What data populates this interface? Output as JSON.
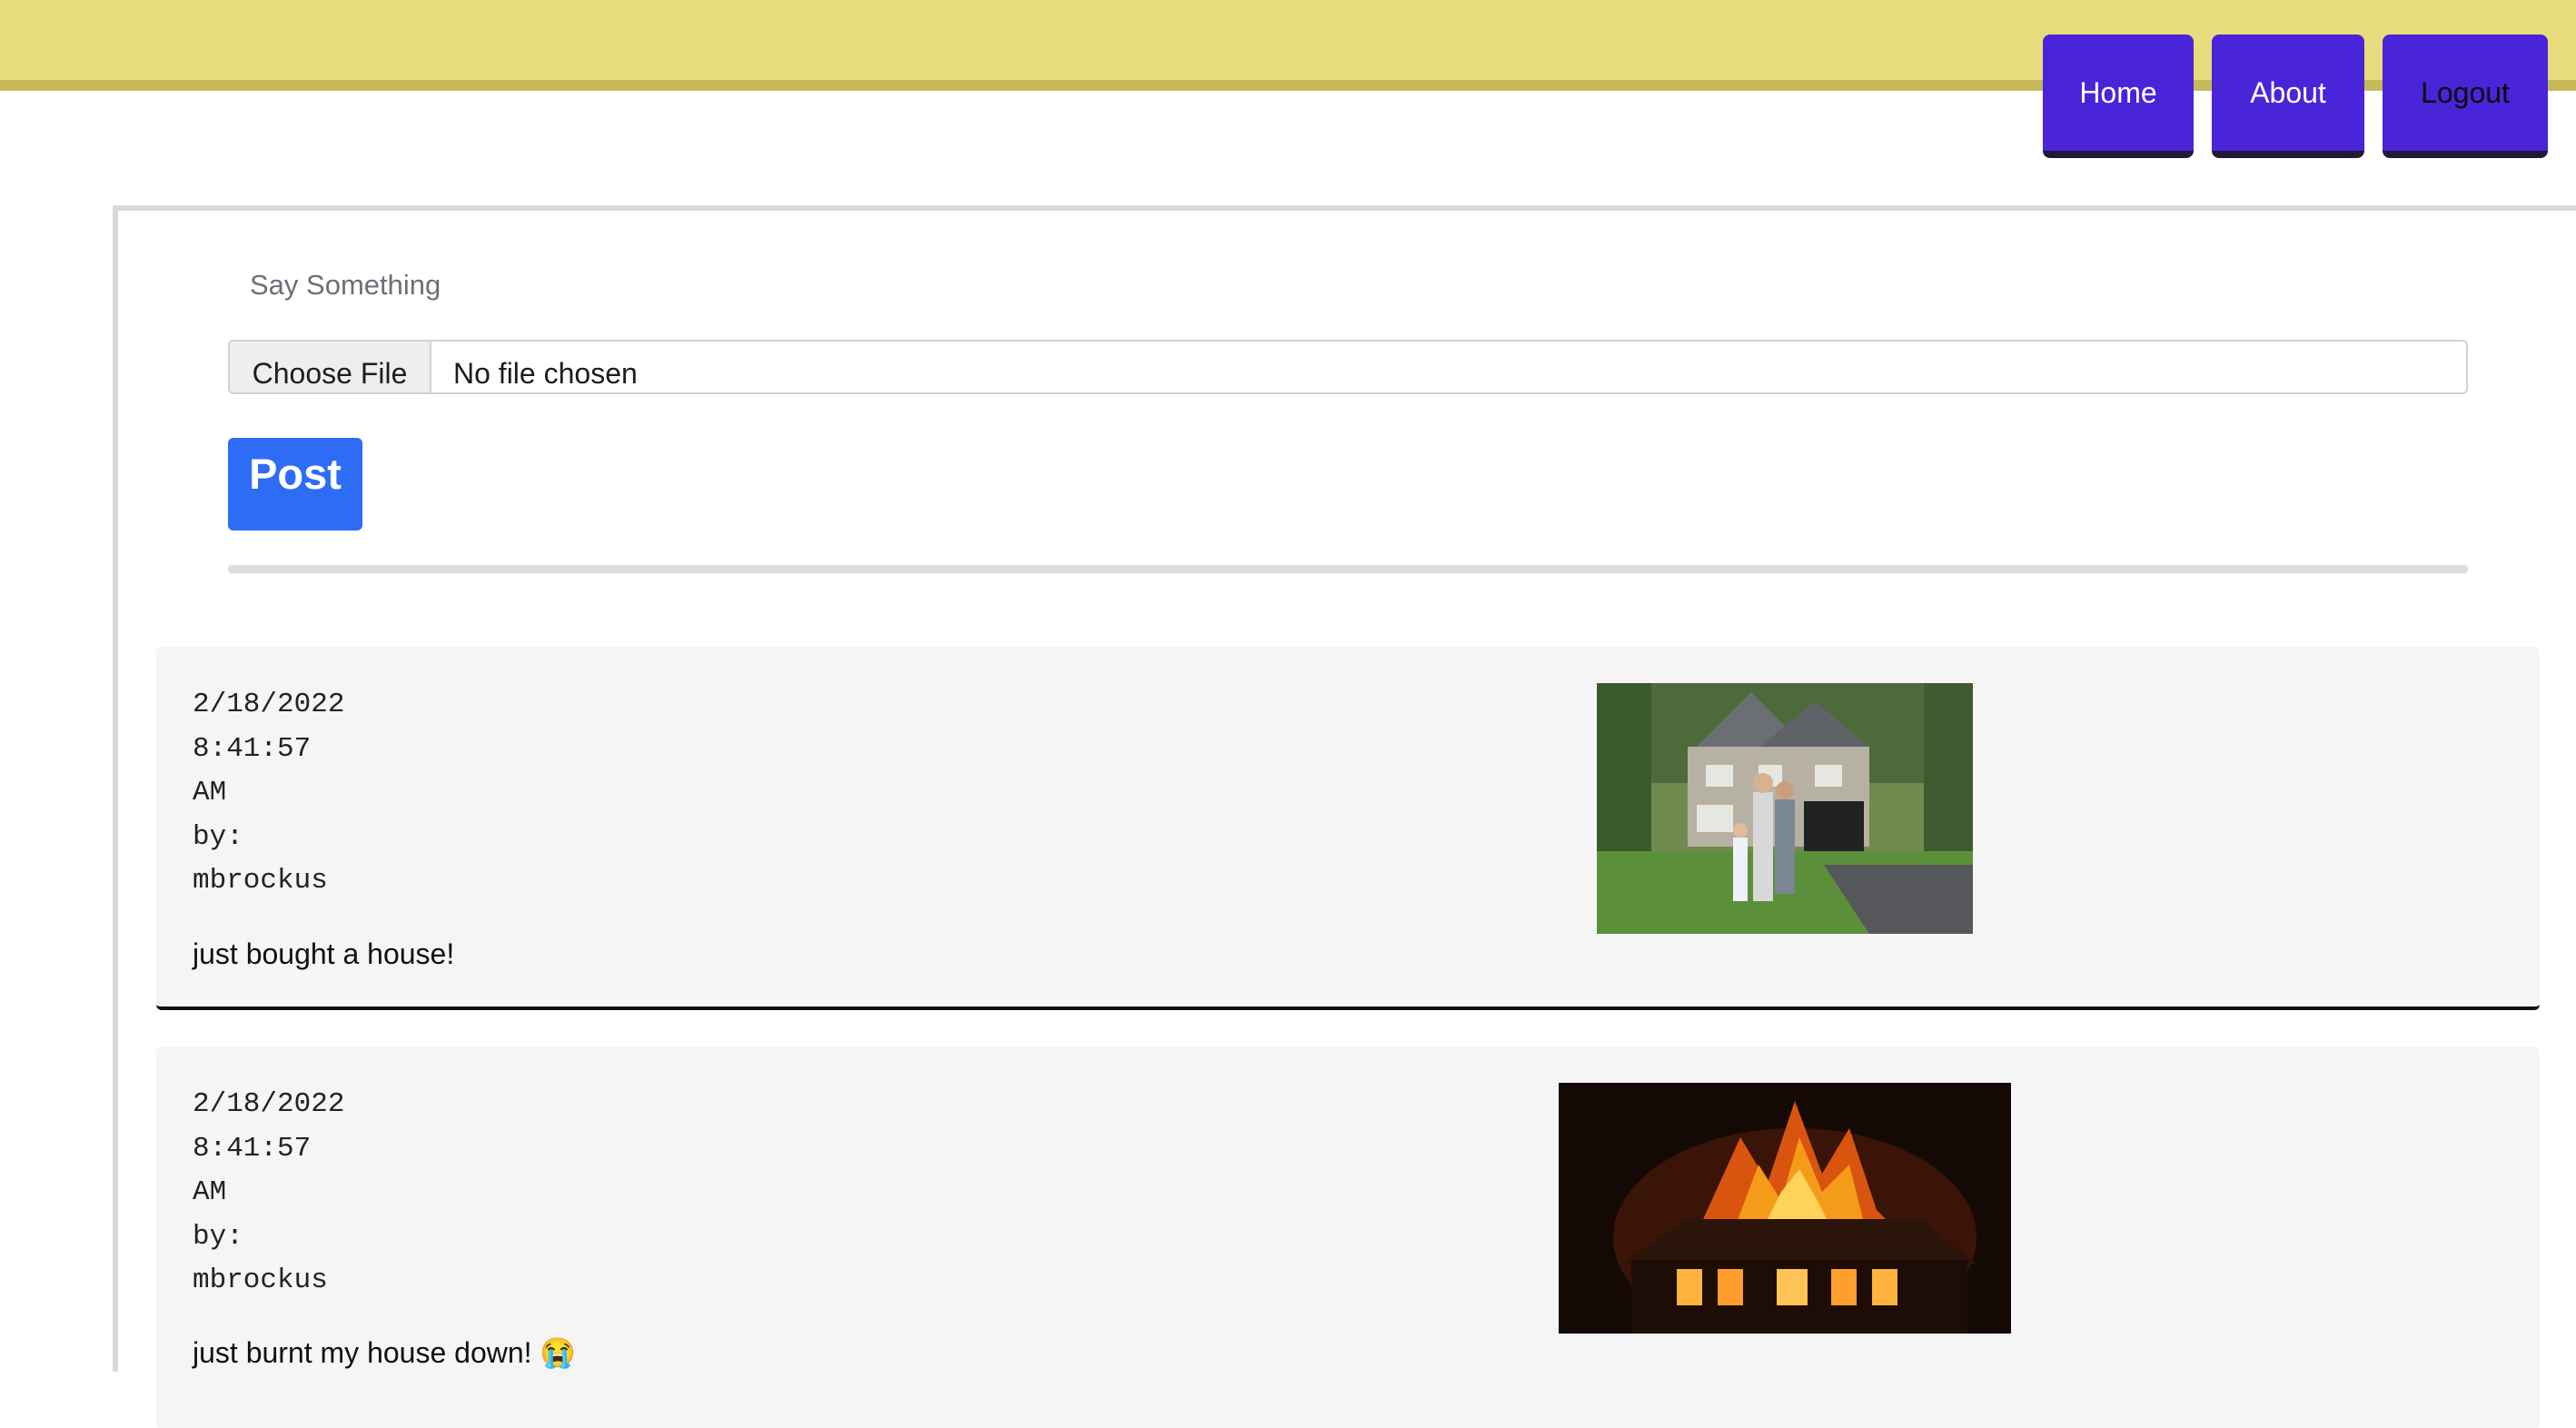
{
  "header": {
    "nav": {
      "home": "Home",
      "about": "About",
      "logout": "Logout"
    }
  },
  "composer": {
    "prompt": "Say Something",
    "file_button": "Choose File",
    "file_status": "No file chosen",
    "post_label": "Post"
  },
  "posts": [
    {
      "date": "2/18/2022",
      "time": "8:41:57",
      "ampm": "AM",
      "by": "by:",
      "author": "mbrockus",
      "text": "just bought a house!",
      "image": "family-in-front-of-house"
    },
    {
      "date": "2/18/2022",
      "time": "8:41:57",
      "ampm": "AM",
      "by": "by:",
      "author": "mbrockus",
      "text": "just burnt my house down! 😭",
      "image": "house-on-fire"
    }
  ],
  "colors": {
    "header": "#e9dc7e",
    "nav": "#4a24d9",
    "post_button": "#2f6cf6",
    "card": "#f5f5f5"
  }
}
